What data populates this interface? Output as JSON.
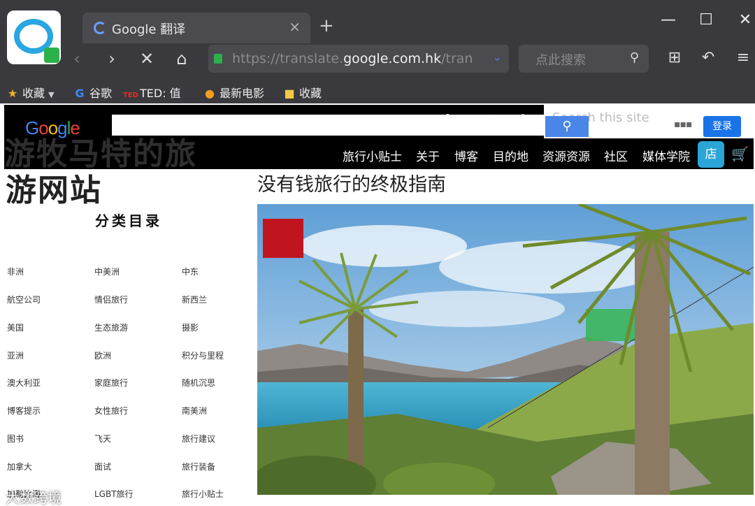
{
  "browser": {
    "tab_title": "Google 翻译",
    "url_dim_prefix": "https://translate.",
    "url_bright": "google.com.hk",
    "url_dim_suffix": "/tran",
    "search_placeholder": "点此搜索",
    "bookmarks": [
      {
        "label": "收藏",
        "icon": "star-icon"
      },
      {
        "label": "谷歌",
        "icon": "google-icon"
      },
      {
        "label": "TED: 值",
        "icon": "ted-icon"
      },
      {
        "label": "最新电影",
        "icon": "play-icon"
      },
      {
        "label": "收藏",
        "icon": "folder-icon"
      }
    ]
  },
  "site": {
    "search_placeholder": "Search this site",
    "login": "登录",
    "nav": [
      "旅行小贴士",
      "关于",
      "博客",
      "目的地",
      "资源资源",
      "社区",
      "媒体学院"
    ],
    "shop": "店",
    "title_line1": "游牧马特的旅",
    "title_line2": "游网站",
    "article_title": "没有钱旅行的终极指南",
    "category_heading": "分类目录",
    "categories": [
      [
        "非洲",
        "中美洲",
        "中东"
      ],
      [
        "航空公司",
        "情侣旅行",
        "新西兰"
      ],
      [
        "美国",
        "生态旅游",
        "摄影"
      ],
      [
        "亚洲",
        "欧洲",
        "积分与里程"
      ],
      [
        "澳大利亚",
        "家庭旅行",
        "随机沉思"
      ],
      [
        "博客提示",
        "女性旅行",
        "南美洲"
      ],
      [
        "图书",
        "飞天",
        "旅行建议"
      ],
      [
        "加拿大",
        "面试",
        "旅行装备"
      ],
      [
        "加勒比海",
        "LGBT旅行",
        "旅行小贴士"
      ]
    ],
    "watermark": "大数跨境"
  },
  "colors": {
    "chrome_bg": "#3a3a3e",
    "accent_blue": "#1a73e8",
    "shop_blue": "#2ba5d8",
    "red_badge": "#c0141f"
  }
}
